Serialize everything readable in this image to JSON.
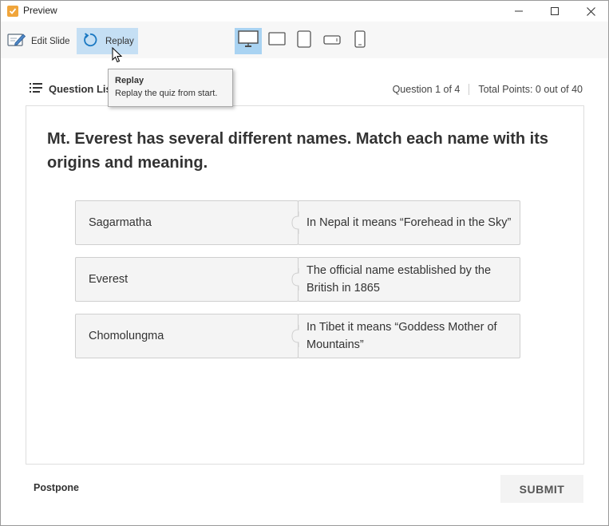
{
  "window": {
    "title": "Preview"
  },
  "toolbar": {
    "edit_label": "Edit Slide",
    "replay_label": "Replay",
    "devices": [
      "desktop-icon",
      "tablet-landscape-icon",
      "tablet-portrait-icon",
      "phone-landscape-icon",
      "phone-portrait-icon"
    ],
    "active_device": "desktop-icon"
  },
  "tooltip": {
    "title": "Replay",
    "text": "Replay the quiz from start."
  },
  "header": {
    "question_list_label": "Question List",
    "question_counter": "Question 1 of 4",
    "total_points": "Total Points: 0 out of 40"
  },
  "slide": {
    "question": "Mt. Everest has several different names. Match each name with its origins and meaning.",
    "pairs": [
      {
        "left": "Sagarmatha",
        "right": "In Nepal it means “Forehead in the Sky”"
      },
      {
        "left": "Everest",
        "right": "The official name established by the British in 1865"
      },
      {
        "left": "Chomolungma",
        "right": "In Tibet it means “Goddess Mother of Mountains”"
      }
    ]
  },
  "footer": {
    "postpone_label": "Postpone",
    "submit_label": "SUBMIT"
  },
  "colors": {
    "replay_bg": "#c5dff4",
    "active_device_bg": "#a9d3f2",
    "app_icon": "#f0a53b"
  }
}
